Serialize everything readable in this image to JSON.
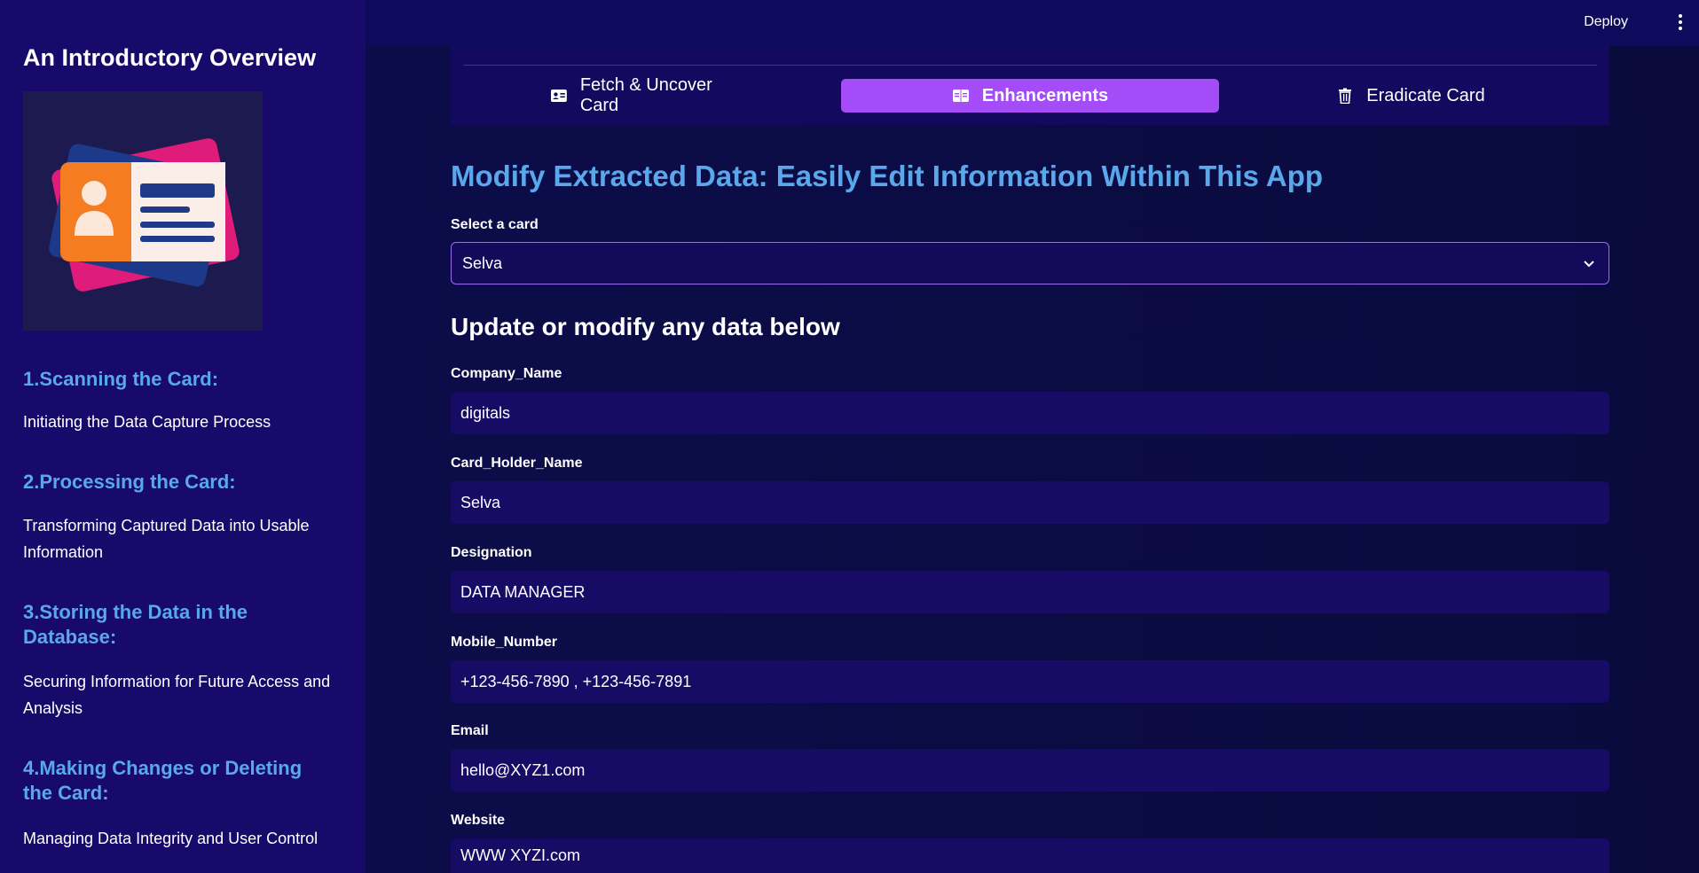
{
  "header": {
    "deploy_label": "Deploy"
  },
  "sidebar": {
    "title": "An Introductory Overview",
    "sections": [
      {
        "heading": "1.Scanning the Card:",
        "text": "Initiating the Data Capture Process"
      },
      {
        "heading": "2.Processing the Card:",
        "text": "Transforming Captured Data into Usable Information"
      },
      {
        "heading": "3.Storing the Data in the Database:",
        "text": "Securing Information for Future Access and Analysis"
      },
      {
        "heading": "4.Making Changes or Deleting the Card:",
        "text": "Managing Data Integrity and User Control"
      }
    ]
  },
  "tabs": [
    {
      "label": "Fetch & Uncover Card",
      "icon": "id-card-icon",
      "active": false
    },
    {
      "label": "Enhancements",
      "icon": "book-icon",
      "active": true
    },
    {
      "label": "Eradicate Card",
      "icon": "trash-icon",
      "active": false
    }
  ],
  "main": {
    "title": "Modify Extracted Data: Easily Edit Information Within This App",
    "select_label": "Select a card",
    "select_value": "Selva",
    "section_heading": "Update or modify any data below",
    "fields": [
      {
        "label": "Company_Name",
        "value": "digitals"
      },
      {
        "label": "Card_Holder_Name",
        "value": "Selva"
      },
      {
        "label": "Designation",
        "value": "DATA MANAGER"
      },
      {
        "label": "Mobile_Number",
        "value": "+123-456-7890 , +123-456-7891"
      },
      {
        "label": "Email",
        "value": "hello@XYZ1.com"
      },
      {
        "label": "Website",
        "value": "WWW XYZI.com"
      }
    ]
  },
  "colors": {
    "accent": "#a34cf7",
    "heading_blue": "#5aa8ec",
    "sidebar_bg": "#170a6b",
    "main_bg": "#0b0b40"
  }
}
